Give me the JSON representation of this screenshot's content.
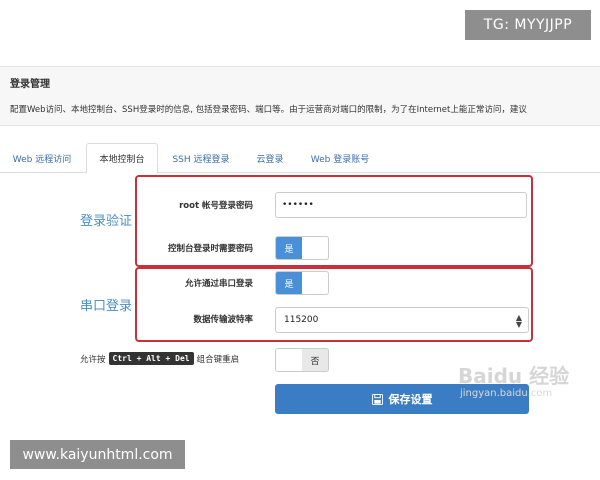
{
  "watermarks": {
    "top": "TG: MYYJJPP",
    "bottom": "www.kaiyunhtml.com",
    "baidu": "Baidu 经验",
    "jingyan": "jingyan.baidu.com"
  },
  "panel": {
    "title": "登录管理",
    "description": "配置Web访问、本地控制台、SSH登录时的信息, 包括登录密码、端口等。由于运营商对端口的限制，为了在Internet上能正常访问，建议"
  },
  "tabs": [
    {
      "label": "Web 远程访问",
      "active": false
    },
    {
      "label": "本地控制台",
      "active": true
    },
    {
      "label": "SSH 远程登录",
      "active": false
    },
    {
      "label": "云登录",
      "active": false
    },
    {
      "label": "Web 登录账号",
      "active": false
    }
  ],
  "login_verify": {
    "section_label": "登录验证",
    "password_label": "root 帐号登录密码",
    "password_value": "••••••",
    "console_require_label": "控制台登录时需要密码",
    "console_require_state": "是"
  },
  "serial_login": {
    "section_label": "串口登录",
    "allow_label": "允许通过串口登录",
    "allow_state": "是",
    "baud_label": "数据传输波特率",
    "baud_value": "115200"
  },
  "cad": {
    "prefix": "允许按",
    "keys": "Ctrl + Alt + Del",
    "suffix": "组合键重启",
    "state": "否"
  },
  "save_button": "保存设置",
  "colors": {
    "accent": "#3b7dc4",
    "highlight_border": "#c9303a",
    "section_label": "#4a8fc6",
    "toggle_on": "#4a90d9"
  }
}
